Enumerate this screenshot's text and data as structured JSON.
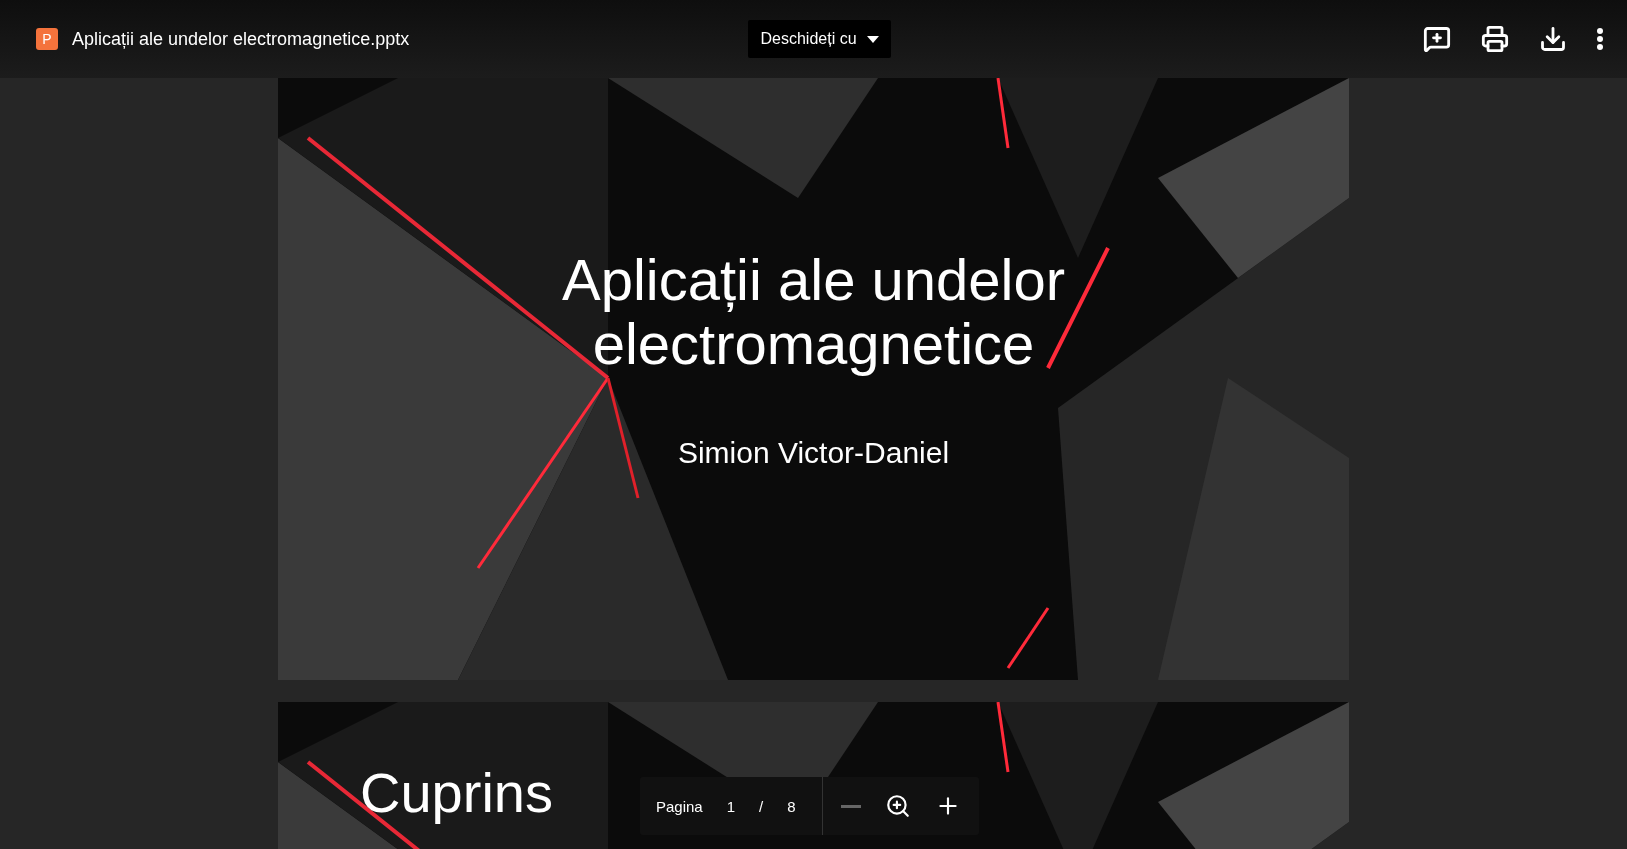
{
  "file": {
    "icon_letter": "P",
    "name": "Aplicații ale undelor electromagnetice.pptx"
  },
  "open_with": {
    "label": "Deschideți cu"
  },
  "actions": [
    {
      "kind": "comment"
    },
    {
      "kind": "print"
    },
    {
      "kind": "download"
    },
    {
      "kind": "more"
    }
  ],
  "slides": [
    {
      "kind": "title",
      "title": "Aplicații ale undelor electromagnetice",
      "subtitle": "Simion Victor-Daniel"
    },
    {
      "kind": "heading",
      "title": "Cuprins"
    }
  ],
  "page_nav": {
    "label": "Pagina",
    "current": "1",
    "separator": "/",
    "total": "8",
    "zoom_out": {
      "disabled": true
    }
  }
}
